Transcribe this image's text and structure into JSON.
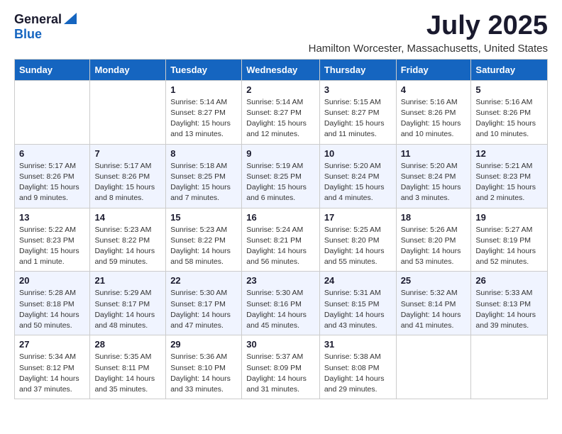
{
  "logo": {
    "general": "General",
    "blue": "Blue"
  },
  "title": "July 2025",
  "subtitle": "Hamilton Worcester, Massachusetts, United States",
  "days_of_week": [
    "Sunday",
    "Monday",
    "Tuesday",
    "Wednesday",
    "Thursday",
    "Friday",
    "Saturday"
  ],
  "weeks": [
    [
      {
        "day": "",
        "sunrise": "",
        "sunset": "",
        "daylight": ""
      },
      {
        "day": "",
        "sunrise": "",
        "sunset": "",
        "daylight": ""
      },
      {
        "day": "1",
        "sunrise": "Sunrise: 5:14 AM",
        "sunset": "Sunset: 8:27 PM",
        "daylight": "Daylight: 15 hours and 13 minutes."
      },
      {
        "day": "2",
        "sunrise": "Sunrise: 5:14 AM",
        "sunset": "Sunset: 8:27 PM",
        "daylight": "Daylight: 15 hours and 12 minutes."
      },
      {
        "day": "3",
        "sunrise": "Sunrise: 5:15 AM",
        "sunset": "Sunset: 8:27 PM",
        "daylight": "Daylight: 15 hours and 11 minutes."
      },
      {
        "day": "4",
        "sunrise": "Sunrise: 5:16 AM",
        "sunset": "Sunset: 8:26 PM",
        "daylight": "Daylight: 15 hours and 10 minutes."
      },
      {
        "day": "5",
        "sunrise": "Sunrise: 5:16 AM",
        "sunset": "Sunset: 8:26 PM",
        "daylight": "Daylight: 15 hours and 10 minutes."
      }
    ],
    [
      {
        "day": "6",
        "sunrise": "Sunrise: 5:17 AM",
        "sunset": "Sunset: 8:26 PM",
        "daylight": "Daylight: 15 hours and 9 minutes."
      },
      {
        "day": "7",
        "sunrise": "Sunrise: 5:17 AM",
        "sunset": "Sunset: 8:26 PM",
        "daylight": "Daylight: 15 hours and 8 minutes."
      },
      {
        "day": "8",
        "sunrise": "Sunrise: 5:18 AM",
        "sunset": "Sunset: 8:25 PM",
        "daylight": "Daylight: 15 hours and 7 minutes."
      },
      {
        "day": "9",
        "sunrise": "Sunrise: 5:19 AM",
        "sunset": "Sunset: 8:25 PM",
        "daylight": "Daylight: 15 hours and 6 minutes."
      },
      {
        "day": "10",
        "sunrise": "Sunrise: 5:20 AM",
        "sunset": "Sunset: 8:24 PM",
        "daylight": "Daylight: 15 hours and 4 minutes."
      },
      {
        "day": "11",
        "sunrise": "Sunrise: 5:20 AM",
        "sunset": "Sunset: 8:24 PM",
        "daylight": "Daylight: 15 hours and 3 minutes."
      },
      {
        "day": "12",
        "sunrise": "Sunrise: 5:21 AM",
        "sunset": "Sunset: 8:23 PM",
        "daylight": "Daylight: 15 hours and 2 minutes."
      }
    ],
    [
      {
        "day": "13",
        "sunrise": "Sunrise: 5:22 AM",
        "sunset": "Sunset: 8:23 PM",
        "daylight": "Daylight: 15 hours and 1 minute."
      },
      {
        "day": "14",
        "sunrise": "Sunrise: 5:23 AM",
        "sunset": "Sunset: 8:22 PM",
        "daylight": "Daylight: 14 hours and 59 minutes."
      },
      {
        "day": "15",
        "sunrise": "Sunrise: 5:23 AM",
        "sunset": "Sunset: 8:22 PM",
        "daylight": "Daylight: 14 hours and 58 minutes."
      },
      {
        "day": "16",
        "sunrise": "Sunrise: 5:24 AM",
        "sunset": "Sunset: 8:21 PM",
        "daylight": "Daylight: 14 hours and 56 minutes."
      },
      {
        "day": "17",
        "sunrise": "Sunrise: 5:25 AM",
        "sunset": "Sunset: 8:20 PM",
        "daylight": "Daylight: 14 hours and 55 minutes."
      },
      {
        "day": "18",
        "sunrise": "Sunrise: 5:26 AM",
        "sunset": "Sunset: 8:20 PM",
        "daylight": "Daylight: 14 hours and 53 minutes."
      },
      {
        "day": "19",
        "sunrise": "Sunrise: 5:27 AM",
        "sunset": "Sunset: 8:19 PM",
        "daylight": "Daylight: 14 hours and 52 minutes."
      }
    ],
    [
      {
        "day": "20",
        "sunrise": "Sunrise: 5:28 AM",
        "sunset": "Sunset: 8:18 PM",
        "daylight": "Daylight: 14 hours and 50 minutes."
      },
      {
        "day": "21",
        "sunrise": "Sunrise: 5:29 AM",
        "sunset": "Sunset: 8:17 PM",
        "daylight": "Daylight: 14 hours and 48 minutes."
      },
      {
        "day": "22",
        "sunrise": "Sunrise: 5:30 AM",
        "sunset": "Sunset: 8:17 PM",
        "daylight": "Daylight: 14 hours and 47 minutes."
      },
      {
        "day": "23",
        "sunrise": "Sunrise: 5:30 AM",
        "sunset": "Sunset: 8:16 PM",
        "daylight": "Daylight: 14 hours and 45 minutes."
      },
      {
        "day": "24",
        "sunrise": "Sunrise: 5:31 AM",
        "sunset": "Sunset: 8:15 PM",
        "daylight": "Daylight: 14 hours and 43 minutes."
      },
      {
        "day": "25",
        "sunrise": "Sunrise: 5:32 AM",
        "sunset": "Sunset: 8:14 PM",
        "daylight": "Daylight: 14 hours and 41 minutes."
      },
      {
        "day": "26",
        "sunrise": "Sunrise: 5:33 AM",
        "sunset": "Sunset: 8:13 PM",
        "daylight": "Daylight: 14 hours and 39 minutes."
      }
    ],
    [
      {
        "day": "27",
        "sunrise": "Sunrise: 5:34 AM",
        "sunset": "Sunset: 8:12 PM",
        "daylight": "Daylight: 14 hours and 37 minutes."
      },
      {
        "day": "28",
        "sunrise": "Sunrise: 5:35 AM",
        "sunset": "Sunset: 8:11 PM",
        "daylight": "Daylight: 14 hours and 35 minutes."
      },
      {
        "day": "29",
        "sunrise": "Sunrise: 5:36 AM",
        "sunset": "Sunset: 8:10 PM",
        "daylight": "Daylight: 14 hours and 33 minutes."
      },
      {
        "day": "30",
        "sunrise": "Sunrise: 5:37 AM",
        "sunset": "Sunset: 8:09 PM",
        "daylight": "Daylight: 14 hours and 31 minutes."
      },
      {
        "day": "31",
        "sunrise": "Sunrise: 5:38 AM",
        "sunset": "Sunset: 8:08 PM",
        "daylight": "Daylight: 14 hours and 29 minutes."
      },
      {
        "day": "",
        "sunrise": "",
        "sunset": "",
        "daylight": ""
      },
      {
        "day": "",
        "sunrise": "",
        "sunset": "",
        "daylight": ""
      }
    ]
  ]
}
